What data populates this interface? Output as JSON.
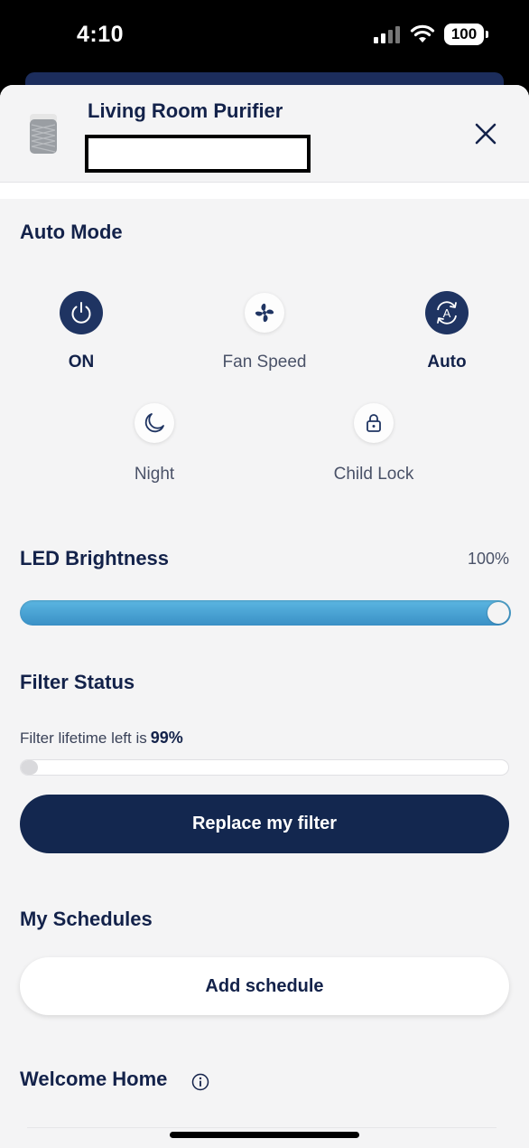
{
  "status_bar": {
    "time": "4:10",
    "battery": "100"
  },
  "header": {
    "title": "Living Room Purifier"
  },
  "auto_mode": {
    "title": "Auto Mode",
    "controls": [
      {
        "label": "ON",
        "icon": "power-icon",
        "active": true
      },
      {
        "label": "Fan Speed",
        "icon": "fan-icon",
        "active": false
      },
      {
        "label": "Auto",
        "icon": "auto-mode-icon",
        "active": true
      },
      {
        "label": "Night",
        "icon": "moon-icon",
        "active": false
      },
      {
        "label": "Child Lock",
        "icon": "lock-icon",
        "active": false
      }
    ]
  },
  "led": {
    "title": "LED Brightness",
    "value": "100%",
    "level": 1.0
  },
  "filter": {
    "title": "Filter Status",
    "text": "Filter lifetime left is",
    "value": "99%",
    "button": "Replace my filter"
  },
  "schedules": {
    "title": "My Schedules",
    "button": "Add schedule"
  },
  "welcome": {
    "title": "Welcome Home"
  },
  "colors": {
    "navy": "#13274f",
    "accent_blue": "#4aa3d6",
    "background": "#f4f4f5"
  }
}
